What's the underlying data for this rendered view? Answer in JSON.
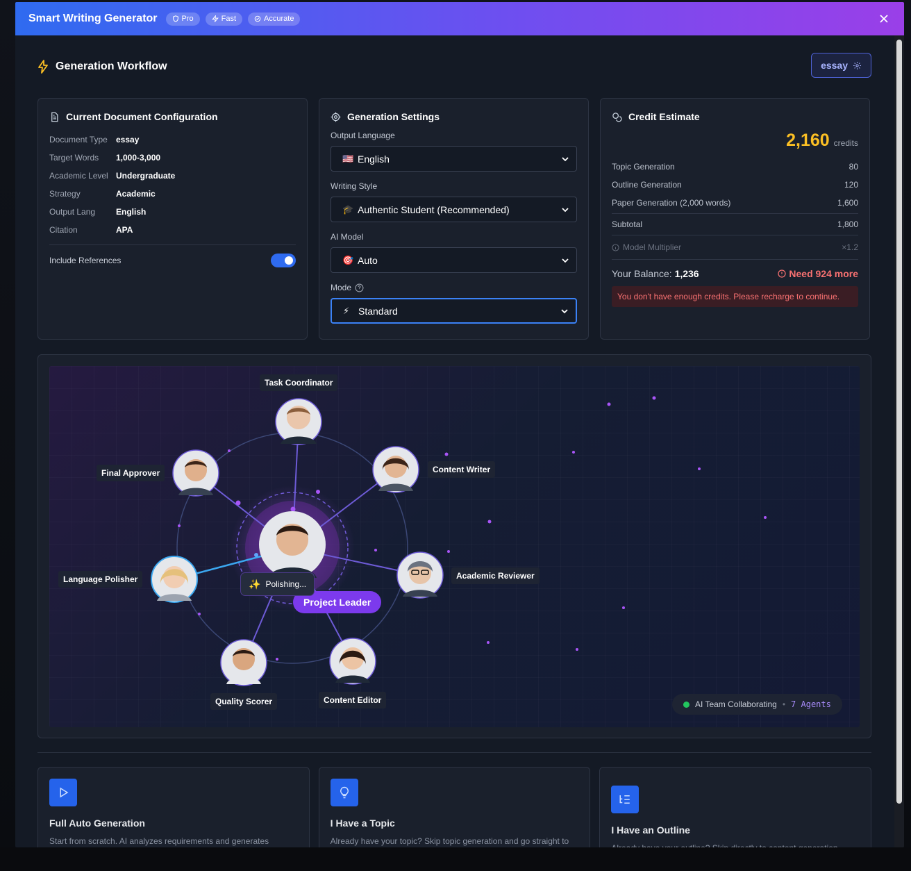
{
  "header": {
    "title": "Smart Writing Generator",
    "badges": [
      {
        "label": "Pro",
        "icon": "shield-icon"
      },
      {
        "label": "Fast",
        "icon": "zap-icon"
      },
      {
        "label": "Accurate",
        "icon": "check-circle-icon"
      }
    ]
  },
  "workflow": {
    "title": "Generation Workflow",
    "doc_type_button": "essay"
  },
  "config": {
    "title": "Current Document Configuration",
    "rows": [
      {
        "label": "Document Type",
        "value": "essay"
      },
      {
        "label": "Target Words",
        "value": "1,000-3,000"
      },
      {
        "label": "Academic Level",
        "value": "Undergraduate"
      },
      {
        "label": "Strategy",
        "value": "Academic"
      },
      {
        "label": "Output Lang",
        "value": "English"
      },
      {
        "label": "Citation",
        "value": "APA"
      }
    ],
    "include_references_label": "Include References",
    "include_references": true
  },
  "settings": {
    "title": "Generation Settings",
    "language_label": "Output Language",
    "language_value": "English",
    "language_icon": "🇺🇸",
    "style_label": "Writing Style",
    "style_value": "Authentic Student (Recommended)",
    "style_icon": "🎓",
    "model_label": "AI Model",
    "model_value": "Auto",
    "model_icon": "🎯",
    "mode_label": "Mode",
    "mode_value": "Standard",
    "mode_icon": "⚡"
  },
  "credits": {
    "title": "Credit Estimate",
    "total": "2,160",
    "unit": "credits",
    "items": [
      {
        "label": "Topic Generation",
        "value": "80"
      },
      {
        "label": "Outline Generation",
        "value": "120"
      },
      {
        "label": "Paper Generation (2,000 words)",
        "value": "1,600"
      }
    ],
    "subtotal_label": "Subtotal",
    "subtotal": "1,800",
    "multiplier_label": "Model Multiplier",
    "multiplier": "×1.2",
    "balance_label": "Your Balance:",
    "balance": "1,236",
    "need": "Need 924 more",
    "warning": "You don't have enough credits. Please recharge to continue."
  },
  "team": {
    "agents": {
      "task_coordinator": "Task Coordinator",
      "content_writer": "Content Writer",
      "academic_reviewer": "Academic Reviewer",
      "content_editor": "Content Editor",
      "quality_scorer": "Quality Scorer",
      "language_polisher": "Language Polisher",
      "final_approver": "Final Approver"
    },
    "leader": "Project Leader",
    "bubble": "Polishing...",
    "status": "AI Team Collaborating",
    "count": "7 Agents"
  },
  "modes": [
    {
      "title": "Full Auto Generation",
      "desc": "Start from scratch. AI analyzes requirements and generates complete content.",
      "icon": "play-icon"
    },
    {
      "title": "I Have a Topic",
      "desc": "Already have your topic? Skip topic generation and go straight to content.",
      "icon": "lightbulb-icon"
    },
    {
      "title": "I Have an Outline",
      "desc": "Already have your outline? Skip directly to content generation.",
      "icon": "list-tree-icon"
    }
  ],
  "colors": {
    "accent": "#2f6bf0",
    "purple": "#7c3aed",
    "credits": "#fbbf24",
    "danger": "#f87171",
    "success": "#22c55e"
  }
}
